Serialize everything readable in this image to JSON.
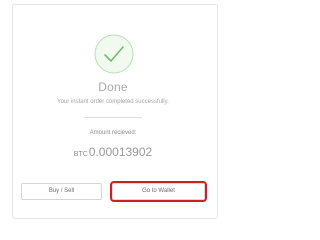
{
  "status": {
    "title": "Done",
    "message": "Your instant order completed successfully.",
    "icon": "checkmark-circle-icon",
    "accent_color": "#7cc37f"
  },
  "amount": {
    "label": "Amount recieved:",
    "currency": "BTC",
    "value": "0.00013902"
  },
  "actions": {
    "buy_sell_label": "Buy / Sell",
    "go_to_wallet_label": "Go to Wallet",
    "highlight_color": "#cc1f26"
  }
}
